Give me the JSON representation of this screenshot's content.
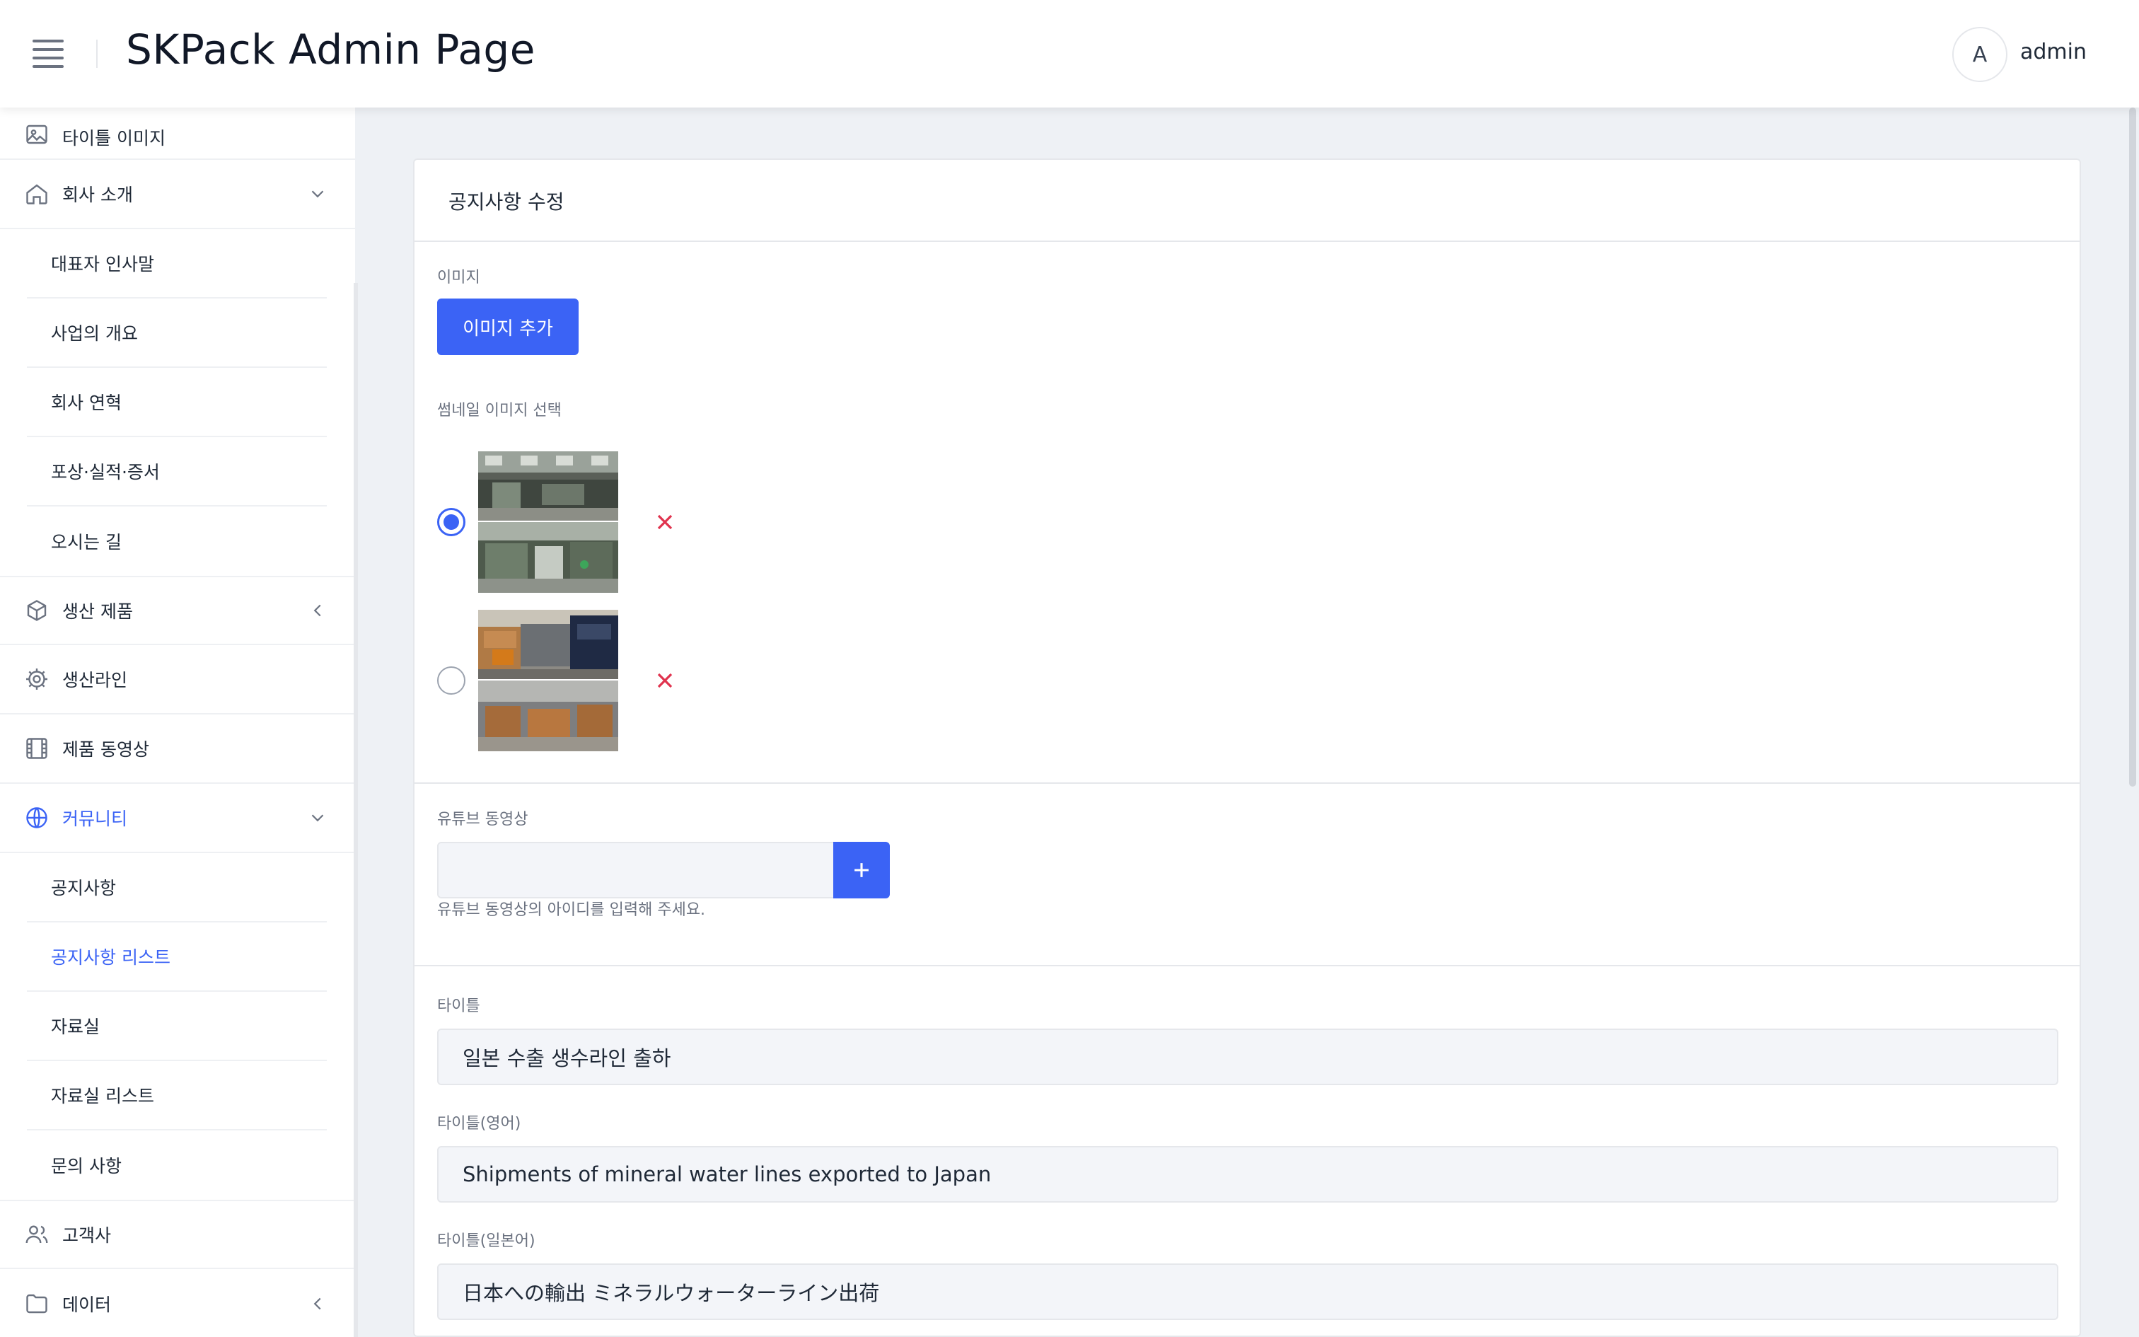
{
  "header": {
    "app_title": "SKPack Admin Page",
    "avatar_initial": "A",
    "username": "admin"
  },
  "sidebar": {
    "items": [
      {
        "label": "타이틀 이미지",
        "icon": "image-icon"
      },
      {
        "label": "회사 소개",
        "icon": "home-icon",
        "expanded": true
      },
      {
        "label": "대표자 인사말"
      },
      {
        "label": "사업의 개요"
      },
      {
        "label": "회사 연혁"
      },
      {
        "label": "포상·실적·증서"
      },
      {
        "label": "오시는 길"
      },
      {
        "label": "생산 제품",
        "icon": "box-icon",
        "expanded": false
      },
      {
        "label": "생산라인",
        "icon": "gear-icon"
      },
      {
        "label": "제품 동영상",
        "icon": "film-icon"
      },
      {
        "label": "커뮤니티",
        "icon": "globe-icon",
        "expanded": true,
        "active": true
      },
      {
        "label": "공지사항"
      },
      {
        "label": "공지사항 리스트",
        "active": true
      },
      {
        "label": "자료실"
      },
      {
        "label": "자료실 리스트"
      },
      {
        "label": "문의 사항"
      },
      {
        "label": "고객사",
        "icon": "users-icon"
      },
      {
        "label": "데이터",
        "icon": "folder-icon",
        "expanded": false
      }
    ]
  },
  "form": {
    "card_title": "공지사항 수정",
    "image_label": "이미지",
    "add_image_button": "이미지 추가",
    "thumbnail_label": "썸네일 이미지 선택",
    "thumbnails": [
      {
        "selected": true,
        "icon": "factory-photo"
      },
      {
        "selected": false,
        "icon": "truck-photo"
      }
    ],
    "youtube_label": "유튜브 동영상",
    "youtube_value": "",
    "youtube_add_icon": "plus-icon",
    "youtube_help": "유튜브 동영상의 아이디를 입력해 주세요.",
    "title_label": "타이틀",
    "title_value": "일본 수출 생수라인 출하",
    "title_en_label": "타이틀(영어)",
    "title_en_value": "Shipments of mineral water lines exported to Japan",
    "title_jp_label": "타이틀(일본어)",
    "title_jp_value": "日本への輸出 ミネラルウォーターライン出荷"
  },
  "colors": {
    "accent": "#3b63f5",
    "remove": "#e0334e",
    "background": "#eef1f5"
  }
}
